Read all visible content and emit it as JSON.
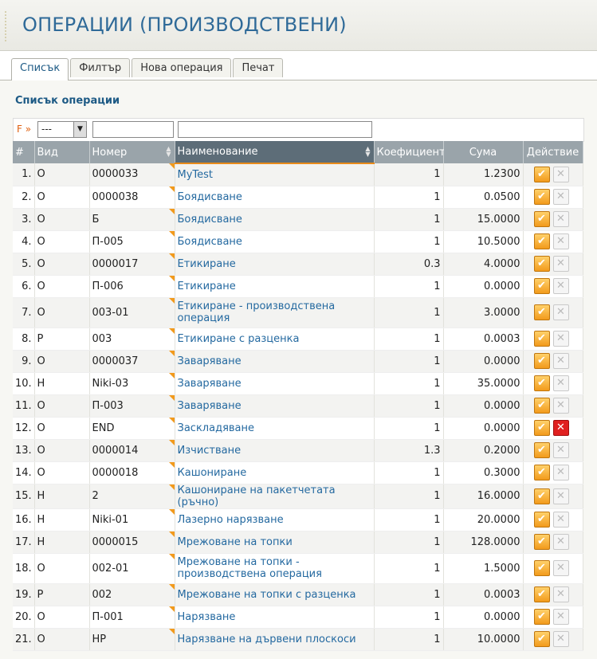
{
  "header": {
    "title": "ОПЕРАЦИИ (ПРОИЗВОДСТВЕНИ)"
  },
  "tabs": [
    {
      "label": "Списък",
      "active": true
    },
    {
      "label": "Филтър",
      "active": false
    },
    {
      "label": "Нова операция",
      "active": false
    },
    {
      "label": "Печат",
      "active": false
    }
  ],
  "list_title": "Списък операции",
  "filter": {
    "label": "F »",
    "select_value": "---",
    "number_value": "",
    "name_value": ""
  },
  "columns": [
    "#",
    "Вид",
    "Номер",
    "Наименование",
    "Коефициент",
    "Сума",
    "Действие"
  ],
  "icons": {
    "edit": "edit-check-icon",
    "delete": "delete-x-icon",
    "sort": "sort-arrows-icon"
  },
  "rows": [
    {
      "idx": "1.",
      "type": "О",
      "number": "0000033",
      "name": "MyTest",
      "coef": "1",
      "sum": "1.2300",
      "del_active": false
    },
    {
      "idx": "2.",
      "type": "О",
      "number": "0000038",
      "name": "Боядисване",
      "coef": "1",
      "sum": "0.0500",
      "del_active": false
    },
    {
      "idx": "3.",
      "type": "О",
      "number": "Б",
      "name": "Боядисване",
      "coef": "1",
      "sum": "15.0000",
      "del_active": false
    },
    {
      "idx": "4.",
      "type": "О",
      "number": "П-005",
      "name": "Боядисване",
      "coef": "1",
      "sum": "10.5000",
      "del_active": false
    },
    {
      "idx": "5.",
      "type": "О",
      "number": "0000017",
      "name": "Етикиране",
      "coef": "0.3",
      "sum": "4.0000",
      "del_active": false
    },
    {
      "idx": "6.",
      "type": "О",
      "number": "П-006",
      "name": "Етикиране",
      "coef": "1",
      "sum": "0.0000",
      "del_active": false
    },
    {
      "idx": "7.",
      "type": "О",
      "number": "003-01",
      "name": "Етикиране - производствена операция",
      "coef": "1",
      "sum": "3.0000",
      "del_active": false,
      "tall": true
    },
    {
      "idx": "8.",
      "type": "Р",
      "number": "003",
      "name": "Етикиране с разценка",
      "coef": "1",
      "sum": "0.0003",
      "del_active": false
    },
    {
      "idx": "9.",
      "type": "О",
      "number": "0000037",
      "name": "Заваряване",
      "coef": "1",
      "sum": "0.0000",
      "del_active": false
    },
    {
      "idx": "10.",
      "type": "Н",
      "number": "Niki-03",
      "name": "Заваряване",
      "coef": "1",
      "sum": "35.0000",
      "del_active": false
    },
    {
      "idx": "11.",
      "type": "О",
      "number": "П-003",
      "name": "Заваряване",
      "coef": "1",
      "sum": "0.0000",
      "del_active": false
    },
    {
      "idx": "12.",
      "type": "О",
      "number": "END",
      "name": "Заскладяване",
      "coef": "1",
      "sum": "0.0000",
      "del_active": true
    },
    {
      "idx": "13.",
      "type": "О",
      "number": "0000014",
      "name": "Изчистване",
      "coef": "1.3",
      "sum": "0.2000",
      "del_active": false
    },
    {
      "idx": "14.",
      "type": "О",
      "number": "0000018",
      "name": "Кашониране",
      "coef": "1",
      "sum": "0.3000",
      "del_active": false
    },
    {
      "idx": "15.",
      "type": "Н",
      "number": "2",
      "name": "Кашониране на пакетчетата (ръчно)",
      "coef": "1",
      "sum": "16.0000",
      "del_active": false
    },
    {
      "idx": "16.",
      "type": "Н",
      "number": "Niki-01",
      "name": "Лазерно нарязване",
      "coef": "1",
      "sum": "20.0000",
      "del_active": false
    },
    {
      "idx": "17.",
      "type": "Н",
      "number": "0000015",
      "name": "Мрежоване на топки",
      "coef": "1",
      "sum": "128.0000",
      "del_active": false
    },
    {
      "idx": "18.",
      "type": "О",
      "number": "002-01",
      "name": "Мрежоване на топки - производствена операция",
      "coef": "1",
      "sum": "1.5000",
      "del_active": false,
      "tall": true
    },
    {
      "idx": "19.",
      "type": "Р",
      "number": "002",
      "name": "Мрежоване на топки с разценка",
      "coef": "1",
      "sum": "0.0003",
      "del_active": false
    },
    {
      "idx": "20.",
      "type": "О",
      "number": "П-001",
      "name": "Нарязване",
      "coef": "1",
      "sum": "0.0000",
      "del_active": false
    },
    {
      "idx": "21.",
      "type": "О",
      "number": "НР",
      "name": "Нарязване на дървени плоскоси",
      "coef": "1",
      "sum": "10.0000",
      "del_active": false
    }
  ]
}
